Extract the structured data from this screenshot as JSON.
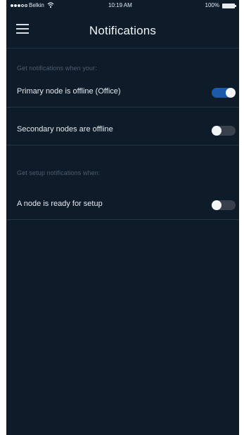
{
  "status_bar": {
    "carrier": "Belkin",
    "time": "10:19 AM",
    "battery": "100%",
    "icons": [
      "signal-icon",
      "wifi-icon",
      "battery-icon"
    ]
  },
  "header": {
    "title": "Notifications",
    "menu_icon": "hamburger-menu-icon"
  },
  "sections": [
    {
      "header": "Get notifications when your:",
      "items": [
        {
          "label": "Primary node is offline (Office)",
          "enabled": true
        },
        {
          "label": "Secondary nodes are offline",
          "enabled": false
        }
      ]
    },
    {
      "header": "Get setup notifications when:",
      "items": [
        {
          "label": "A node is ready for setup",
          "enabled": false
        }
      ]
    }
  ],
  "colors": {
    "background": "#0e1b29",
    "toggle_on": "#1a5aa8",
    "toggle_off": "#38414b",
    "section_header": "#4e5d6e"
  }
}
